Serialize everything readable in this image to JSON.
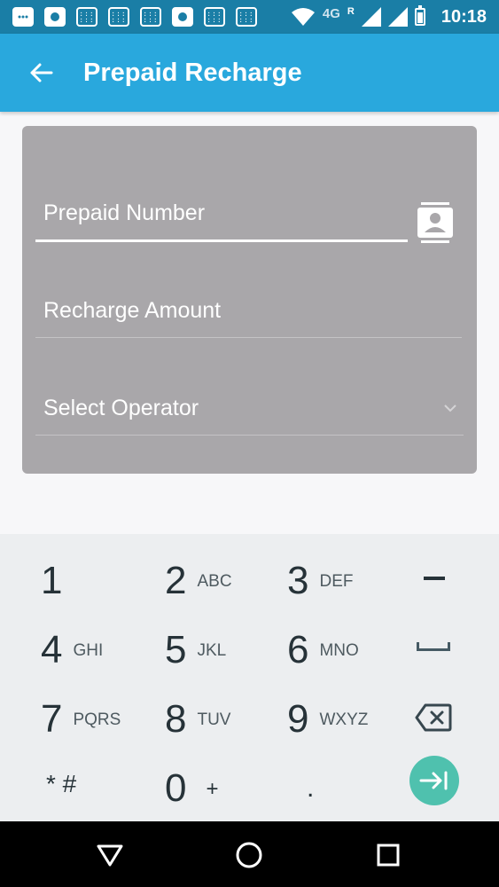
{
  "status_bar": {
    "network": "4G",
    "roaming": "R",
    "time": "10:18"
  },
  "app_bar": {
    "title": "Prepaid Recharge",
    "color": "#29a8dd"
  },
  "form": {
    "prepaid_number": {
      "placeholder": "Prepaid Number",
      "value": ""
    },
    "recharge_amount": {
      "placeholder": "Recharge Amount",
      "value": ""
    },
    "operator": {
      "placeholder": "Select Operator",
      "selected": ""
    }
  },
  "keypad": {
    "keys": [
      {
        "digit": "1",
        "letters": ""
      },
      {
        "digit": "2",
        "letters": "ABC"
      },
      {
        "digit": "3",
        "letters": "DEF"
      },
      {
        "digit": "4",
        "letters": "GHI"
      },
      {
        "digit": "5",
        "letters": "JKL"
      },
      {
        "digit": "6",
        "letters": "MNO"
      },
      {
        "digit": "7",
        "letters": "PQRS"
      },
      {
        "digit": "8",
        "letters": "TUV"
      },
      {
        "digit": "9",
        "letters": "WXYZ"
      },
      {
        "digit": "* #",
        "letters": ""
      },
      {
        "digit": "0",
        "letters": "+"
      },
      {
        "digit": ".",
        "letters": ""
      }
    ],
    "icons": [
      "minus-icon",
      "space-icon",
      "backspace-icon",
      "go-next-icon"
    ],
    "go_color": "#4fc1ae"
  },
  "nav_bar": {
    "icons": [
      "back-triangle-icon",
      "home-circle-icon",
      "recent-square-icon"
    ]
  }
}
